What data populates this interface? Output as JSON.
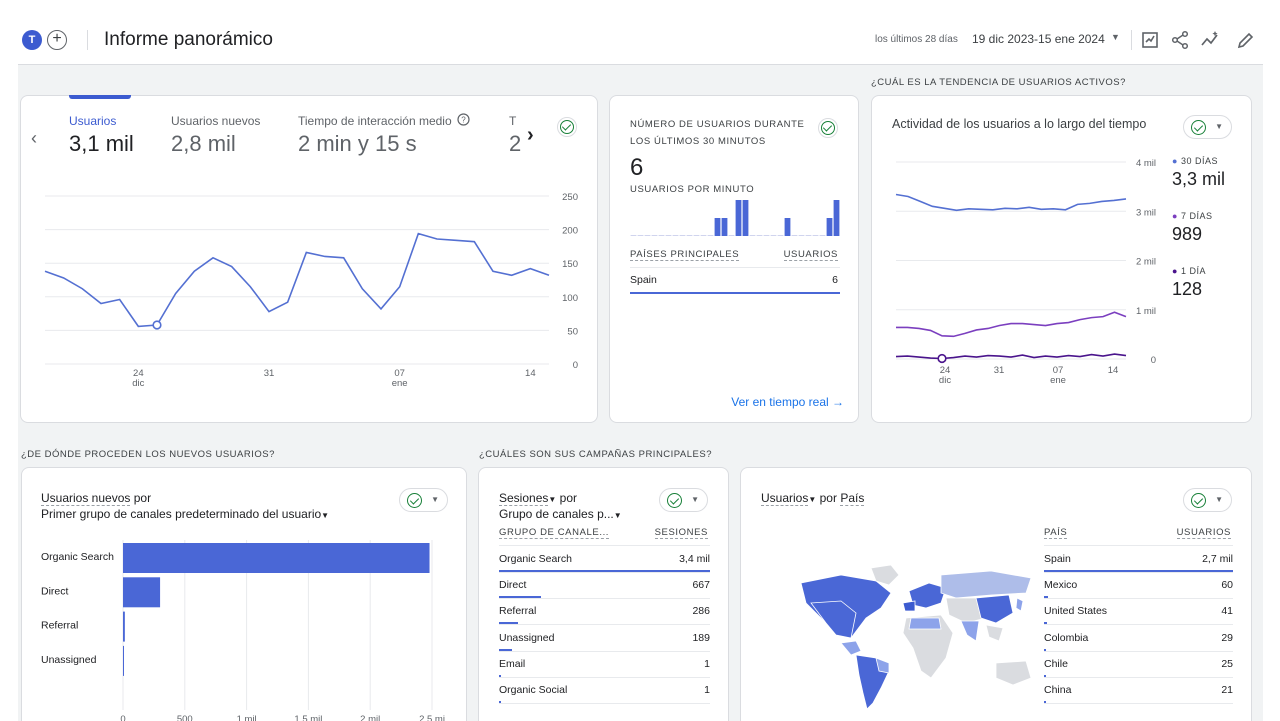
{
  "header": {
    "avatar_letter": "T",
    "title": "Informe panorámico",
    "date_label": "los últimos 28 días",
    "date_range": "19 dic 2023-15 ene 2024"
  },
  "sections": {
    "active_trend": "¿CUÁL ES LA TENDENCIA DE USUARIOS ACTIVOS?",
    "new_users_source": "¿DE DÓNDE PROCEDEN LOS NUEVOS USUARIOS?",
    "campaigns": "¿CUÁLES SON SUS CAMPAÑAS PRINCIPALES?"
  },
  "overview": {
    "metrics": [
      {
        "label": "Usuarios",
        "value": "3,1 mil"
      },
      {
        "label": "Usuarios nuevos",
        "value": "2,8 mil"
      },
      {
        "label": "Tiempo de interacción medio",
        "value": "2 min y 15 s"
      },
      {
        "label": "T",
        "value": "2"
      }
    ]
  },
  "realtime": {
    "title": "NÚMERO DE USUARIOS DURANTE LOS ÚLTIMOS 30 MINUTOS",
    "value": "6",
    "per_minute_label": "USUARIOS POR MINUTO",
    "col_country": "PAÍSES PRINCIPALES",
    "col_users": "USUARIOS",
    "rows": [
      {
        "country": "Spain",
        "users": "6"
      }
    ],
    "link": "Ver en tiempo real"
  },
  "activity": {
    "title": "Actividad de los usuarios a lo largo del tiempo",
    "legend": [
      {
        "label": "30 DÍAS",
        "value": "3,3 mil",
        "color": "#5470d2"
      },
      {
        "label": "7 DÍAS",
        "value": "989",
        "color": "#7b3fbf"
      },
      {
        "label": "1 DÍA",
        "value": "128",
        "color": "#4a148c"
      }
    ]
  },
  "new_users": {
    "title_metric": "Usuarios nuevos",
    "title_by": "por",
    "dimension": "Primer grupo de canales predeterminado del usuario"
  },
  "campaigns": {
    "title_metric": "Sesiones",
    "title_by": "por",
    "dimension": "Grupo de canales p...",
    "col_group": "GRUPO DE CANALE...",
    "col_sessions": "SESIONES",
    "rows": [
      {
        "name": "Organic Search",
        "value": "3,4 mil",
        "share": 1.0
      },
      {
        "name": "Direct",
        "value": "667",
        "share": 0.2
      },
      {
        "name": "Referral",
        "value": "286",
        "share": 0.09
      },
      {
        "name": "Unassigned",
        "value": "189",
        "share": 0.06
      },
      {
        "name": "Email",
        "value": "1",
        "share": 0.0
      },
      {
        "name": "Organic Social",
        "value": "1",
        "share": 0.0
      }
    ]
  },
  "country": {
    "title_metric": "Usuarios",
    "title_by": "por",
    "dimension": "País",
    "col_country": "PAÍS",
    "col_users": "USUARIOS",
    "rows": [
      {
        "name": "Spain",
        "value": "2,7 mil",
        "share": 1.0
      },
      {
        "name": "Mexico",
        "value": "60",
        "share": 0.022
      },
      {
        "name": "United States",
        "value": "41",
        "share": 0.015
      },
      {
        "name": "Colombia",
        "value": "29",
        "share": 0.011
      },
      {
        "name": "Chile",
        "value": "25",
        "share": 0.009
      },
      {
        "name": "China",
        "value": "21",
        "share": 0.008
      }
    ]
  },
  "chart_data": [
    {
      "type": "line",
      "title": "",
      "x_ticks": [
        "24\ndic",
        "31",
        "07\nene",
        "14"
      ],
      "y_ticks": [
        "250",
        "200",
        "150",
        "100",
        "50",
        "0"
      ],
      "ylim": [
        0,
        250
      ],
      "series": [
        {
          "values": [
            138,
            128,
            112,
            90,
            96,
            56,
            58,
            105,
            138,
            158,
            145,
            115,
            78,
            92,
            166,
            160,
            158,
            112,
            82,
            115,
            194,
            186,
            184,
            182,
            138,
            132,
            142,
            132
          ]
        }
      ]
    },
    {
      "type": "bar",
      "title": "",
      "values": [
        0,
        0,
        0,
        0,
        0,
        0,
        0,
        0,
        0,
        0,
        0,
        0,
        1,
        1,
        0,
        2,
        2,
        0,
        0,
        0,
        0,
        0,
        1,
        0,
        0,
        0,
        0,
        0,
        1,
        2
      ]
    },
    {
      "type": "line",
      "title": "",
      "y_ticks": [
        "4 mil",
        "3 mil",
        "2 mil",
        "1 mil",
        "0"
      ],
      "x_ticks": [
        "24\ndic",
        "31",
        "07\nene",
        "14"
      ],
      "ylim": [
        0,
        4000
      ],
      "series": [
        {
          "name": "30 DÍAS",
          "values": [
            3340,
            3300,
            3200,
            3100,
            3060,
            3020,
            3050,
            3040,
            3030,
            3060,
            3050,
            3080,
            3040,
            3050,
            3030,
            3140,
            3160,
            3200,
            3220,
            3250
          ]
        },
        {
          "name": "7 DÍAS",
          "values": [
            640,
            640,
            620,
            580,
            470,
            460,
            520,
            590,
            620,
            680,
            720,
            720,
            700,
            680,
            720,
            740,
            800,
            840,
            860,
            950,
            860
          ]
        },
        {
          "name": "1 DÍA",
          "values": [
            50,
            60,
            40,
            20,
            10,
            30,
            60,
            40,
            70,
            60,
            40,
            80,
            30,
            60,
            40,
            70,
            50,
            90,
            60,
            100,
            70
          ]
        }
      ]
    },
    {
      "type": "bar",
      "title": "",
      "categories": [
        "Organic Search",
        "Direct",
        "Referral",
        "Unassigned"
      ],
      "values": [
        2480,
        300,
        15,
        5
      ],
      "x_ticks": [
        "0",
        "500",
        "1 mil",
        "1,5 mil",
        "2 mil",
        "2,5 mi"
      ],
      "xlim": [
        0,
        2500
      ]
    }
  ]
}
